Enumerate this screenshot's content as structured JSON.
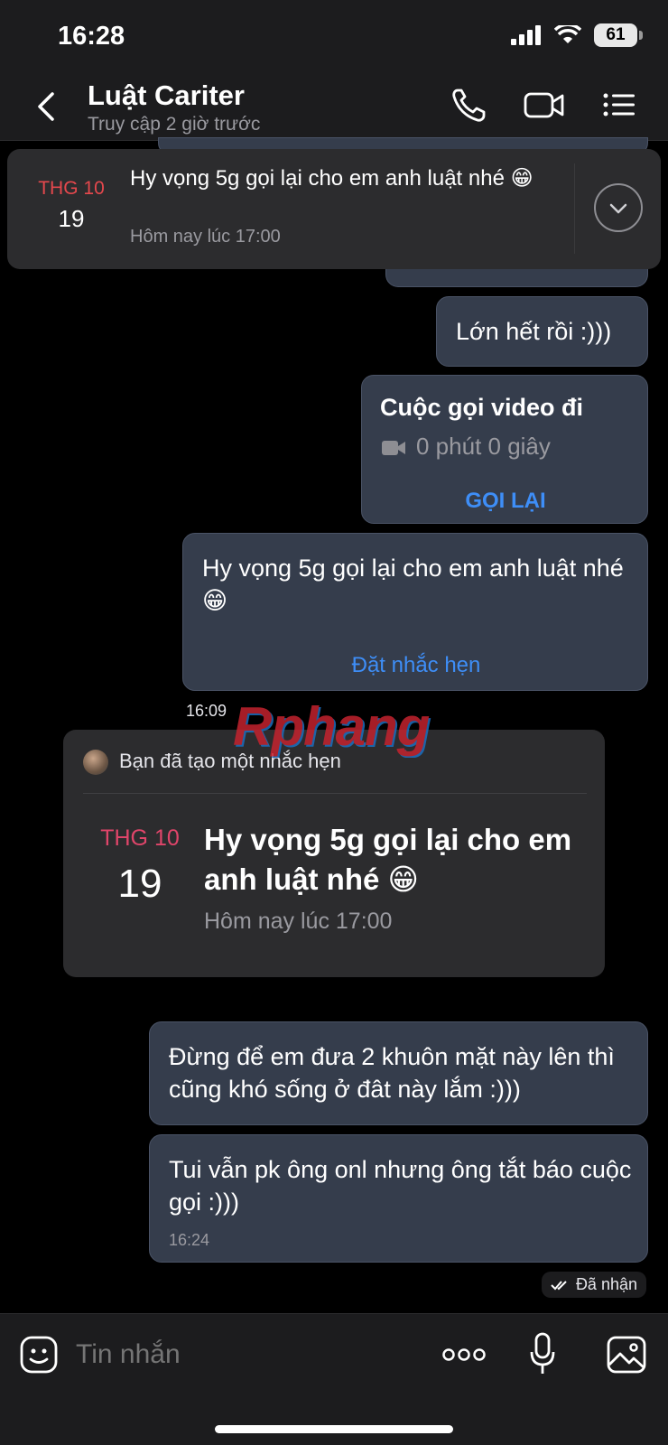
{
  "status_bar": {
    "time": "16:28",
    "battery": "61"
  },
  "header": {
    "name": "Luật Cariter",
    "status": "Truy cập 2 giờ trước"
  },
  "pinned_reminder": {
    "month": "THG 10",
    "day": "19",
    "text": "Hy vọng 5g gọi lại cho em anh luật nhé 😁",
    "subtitle": "Hôm nay lúc 17:00"
  },
  "messages": {
    "m1": "Lớn hết rồi :)))",
    "call": {
      "title": "Cuộc gọi video đi",
      "duration": "0 phút 0 giây",
      "action": "GỌI LẠI"
    },
    "m2": {
      "text": "Hy vọng 5g gọi lại cho em anh luật nhé 😁",
      "action": "Đặt nhắc hẹn"
    },
    "time1": "16:09",
    "m3": "Đừng để em đưa 2 khuôn mặt này lên thì cũng khó sống ở đât này lắm :)))",
    "m4": {
      "text": "Tui vẫn pk ông onl nhưng ông tắt báo cuộc gọi :)))",
      "time": "16:24"
    },
    "receipt": "Đã nhận"
  },
  "reminder_card": {
    "header": "Bạn đã tạo một nhắc hẹn",
    "month": "THG 10",
    "day": "19",
    "title": "Hy vọng 5g gọi lại cho em anh luật nhé 😁",
    "subtitle": "Hôm nay lúc 17:00"
  },
  "watermark": "Rphang",
  "composer": {
    "placeholder": "Tin nhắn"
  },
  "colors": {
    "bubble": "#353d4c",
    "link": "#3e8ef7",
    "month_red": "#e5484d",
    "background": "#000000"
  }
}
